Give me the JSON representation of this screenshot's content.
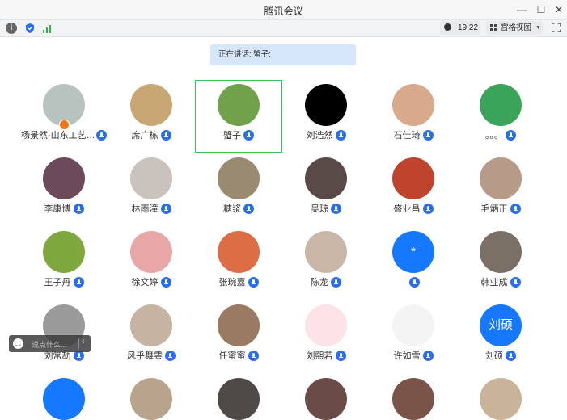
{
  "window": {
    "title": "腾讯会议"
  },
  "toolbar": {
    "time": "19:22",
    "view_label": "宫格视图"
  },
  "banner": {
    "speaking": "正在讲话: 蟹子;"
  },
  "chat": {
    "placeholder": "说点什么..."
  },
  "participants": [
    {
      "name": "杨景然-山东工艺…",
      "bg": "#b8c2bf",
      "avatar_text": ""
    },
    {
      "name": "席广栋",
      "bg": "#c8a774",
      "avatar_text": ""
    },
    {
      "name": "蟹子",
      "bg": "#6fa24a",
      "avatar_text": ""
    },
    {
      "name": "刘浩然",
      "bg": "#000000",
      "avatar_text": ""
    },
    {
      "name": "石佳琦",
      "bg": "#d9a98c",
      "avatar_text": ""
    },
    {
      "name": "。。。",
      "bg": "#3aa55a",
      "avatar_text": ""
    },
    {
      "name": "李康博",
      "bg": "#6d4a5a",
      "avatar_text": ""
    },
    {
      "name": "林雨潼",
      "bg": "#c9c2bd",
      "avatar_text": ""
    },
    {
      "name": "糖浆",
      "bg": "#9a8a72",
      "avatar_text": ""
    },
    {
      "name": "吴琼",
      "bg": "#5a4a47",
      "avatar_text": ""
    },
    {
      "name": "盛业昌",
      "bg": "#c0432e",
      "avatar_text": ""
    },
    {
      "name": "毛炳正",
      "bg": "#b89a88",
      "avatar_text": ""
    },
    {
      "name": "王子丹",
      "bg": "#7ea83e",
      "avatar_text": ""
    },
    {
      "name": "徐文婷",
      "bg": "#e7a7a7",
      "avatar_text": ""
    },
    {
      "name": "张琬嘉",
      "bg": "#dd6d45",
      "avatar_text": ""
    },
    {
      "name": "陈龙",
      "bg": "#c9b6a6",
      "avatar_text": ""
    },
    {
      "name": "",
      "bg": "#1677ff",
      "avatar_text": "*"
    },
    {
      "name": "韩业成",
      "bg": "#7a7066",
      "avatar_text": ""
    },
    {
      "name": "刘常劼",
      "bg": "#9a9a9a",
      "avatar_text": ""
    },
    {
      "name": "风乎舞雩",
      "bg": "#c6b3a1",
      "avatar_text": ""
    },
    {
      "name": "任蜜蜜",
      "bg": "#9a7a62",
      "avatar_text": ""
    },
    {
      "name": "刘熙若",
      "bg": "#fbe3e8",
      "avatar_text": ""
    },
    {
      "name": "许如雪",
      "bg": "#f4f4f4",
      "avatar_text": ""
    },
    {
      "name": "刘硕",
      "bg": "#1677ff",
      "avatar_text": "刘硕"
    }
  ],
  "bottom_row_colors": [
    "#1677ff",
    "#b8a48c",
    "#4f4a45",
    "#6a4b48",
    "#7a5448",
    "#c9b49b"
  ]
}
